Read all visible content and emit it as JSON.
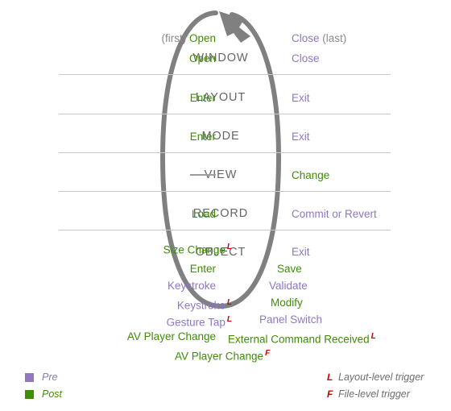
{
  "colors": {
    "pre": "#8f77c4",
    "post": "#3f8c06",
    "trigger": "#d40000",
    "stage_label": "#666666",
    "separator": "#c9c9c9",
    "cycle_arrow": "#808080",
    "muted": "#8a8a8a"
  },
  "stages": [
    {
      "id": "window",
      "label": "WINDOW"
    },
    {
      "id": "layout",
      "label": "LAYOUT"
    },
    {
      "id": "mode",
      "label": "MODE"
    },
    {
      "id": "view",
      "label": "VIEW"
    },
    {
      "id": "record",
      "label": "RECORD"
    },
    {
      "id": "object",
      "label": "OBJECT"
    }
  ],
  "events": {
    "window": {
      "left": [
        {
          "prefix": "(first) ",
          "text": "Open",
          "kind": "post"
        },
        {
          "prefix": "",
          "text": "Open",
          "kind": "post"
        }
      ],
      "right": [
        {
          "text": "Close",
          "suffix": " (last)",
          "kind": "pre"
        },
        {
          "text": "Close",
          "suffix": "",
          "kind": "pre"
        }
      ]
    },
    "layout": {
      "left": [
        {
          "text": "Enter",
          "kind": "post"
        }
      ],
      "right": [
        {
          "text": "Exit",
          "kind": "pre"
        }
      ]
    },
    "mode": {
      "left": [
        {
          "text": "Enter",
          "kind": "post"
        }
      ],
      "right": [
        {
          "text": "Exit",
          "kind": "pre"
        }
      ]
    },
    "view": {
      "left": [
        {
          "text": "—",
          "kind": "none"
        }
      ],
      "right": [
        {
          "text": "Change",
          "kind": "post"
        }
      ]
    },
    "record": {
      "left": [
        {
          "text": "Load",
          "kind": "post"
        }
      ],
      "right": [
        {
          "text": "Commit or Revert",
          "kind": "pre"
        }
      ]
    },
    "object": {
      "left": [
        {
          "text": "Size Change",
          "kind": "post",
          "trigger": "L"
        },
        {
          "text": "Enter",
          "kind": "post"
        },
        {
          "text": "Keystroke",
          "kind": "pre"
        },
        {
          "text": "Keystroke",
          "kind": "pre",
          "trigger": "L"
        },
        {
          "text": "Gesture Tap",
          "kind": "pre",
          "trigger": "L"
        },
        {
          "text": "AV Player Change",
          "kind": "post"
        }
      ],
      "right": [
        {
          "text": "Exit",
          "kind": "pre"
        },
        {
          "text": "Save",
          "kind": "post"
        },
        {
          "text": "Validate",
          "kind": "pre"
        },
        {
          "text": "Modify",
          "kind": "post"
        },
        {
          "text": "Panel Switch",
          "kind": "pre"
        },
        {
          "text": "External Command Received",
          "kind": "post",
          "trigger": "L"
        }
      ],
      "center": [
        {
          "text": "AV Player Change",
          "kind": "post",
          "trigger": "F"
        }
      ]
    }
  },
  "legend": {
    "pre_label": "Pre",
    "post_label": "Post",
    "layout_key": "L",
    "layout_desc": "Layout-level trigger",
    "file_key": "F",
    "file_desc": "File-level trigger"
  }
}
